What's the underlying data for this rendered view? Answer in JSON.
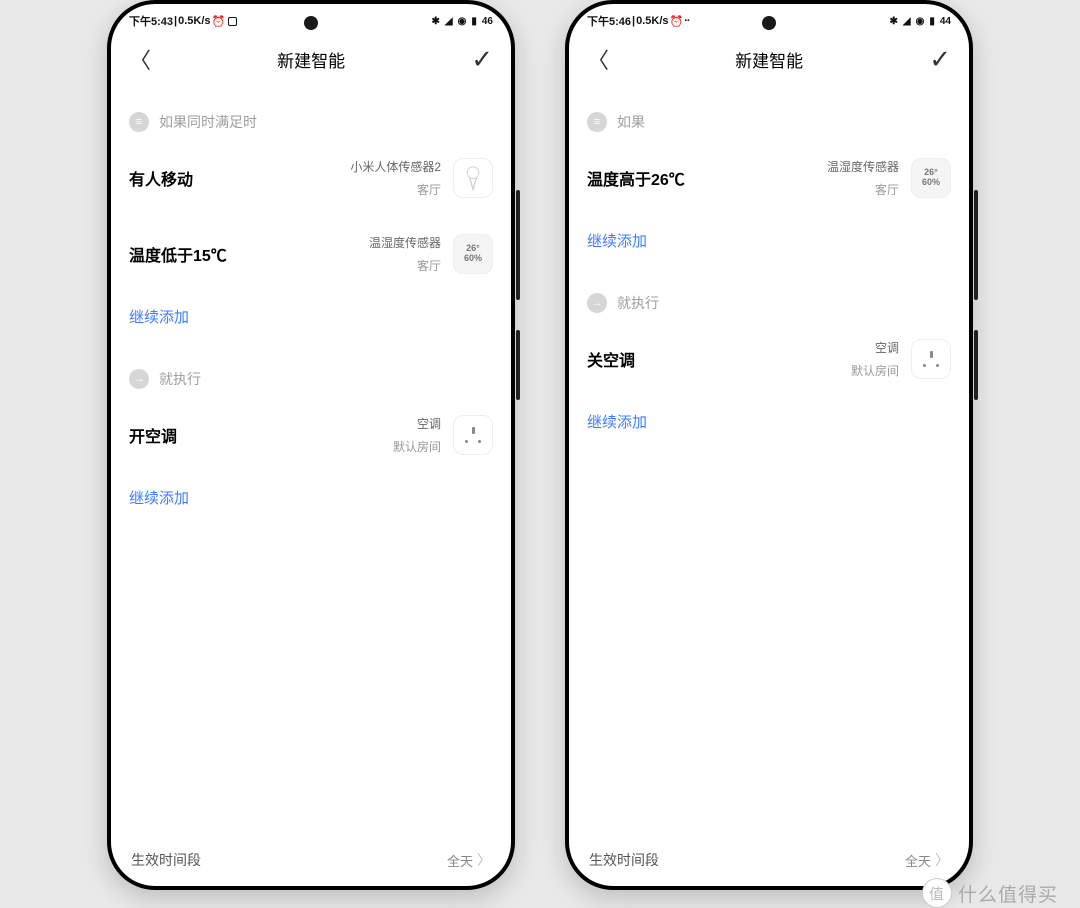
{
  "phones": [
    {
      "status": {
        "time": "下午5:43",
        "net": "0.5K/s",
        "battery": "46"
      },
      "nav": {
        "title": "新建智能"
      },
      "cond_header": "如果同时满足时",
      "conditions": [
        {
          "main": "有人移动",
          "device": "小米人体传感器2",
          "room": "客厅",
          "icon": "motion"
        },
        {
          "main": "温度低于15℃",
          "device": "温湿度传感器",
          "room": "客厅",
          "icon": "temp"
        }
      ],
      "add_cond": "继续添加",
      "action_header": "就执行",
      "actions": [
        {
          "main": "开空调",
          "device": "空调",
          "room": "默认房间",
          "icon": "socket"
        }
      ],
      "add_action": "继续添加",
      "footer": {
        "left": "生效时间段",
        "right": "全天"
      }
    },
    {
      "status": {
        "time": "下午5:46",
        "net": "0.5K/s",
        "battery": "44"
      },
      "nav": {
        "title": "新建智能"
      },
      "cond_header": "如果",
      "conditions": [
        {
          "main": "温度高于26℃",
          "device": "温湿度传感器",
          "room": "客厅",
          "icon": "temp"
        }
      ],
      "add_cond": "继续添加",
      "action_header": "就执行",
      "actions": [
        {
          "main": "关空调",
          "device": "空调",
          "room": "默认房间",
          "icon": "socket"
        }
      ],
      "add_action": "继续添加",
      "footer": {
        "left": "生效时间段",
        "right": "全天"
      }
    }
  ],
  "watermark": "什么值得买"
}
